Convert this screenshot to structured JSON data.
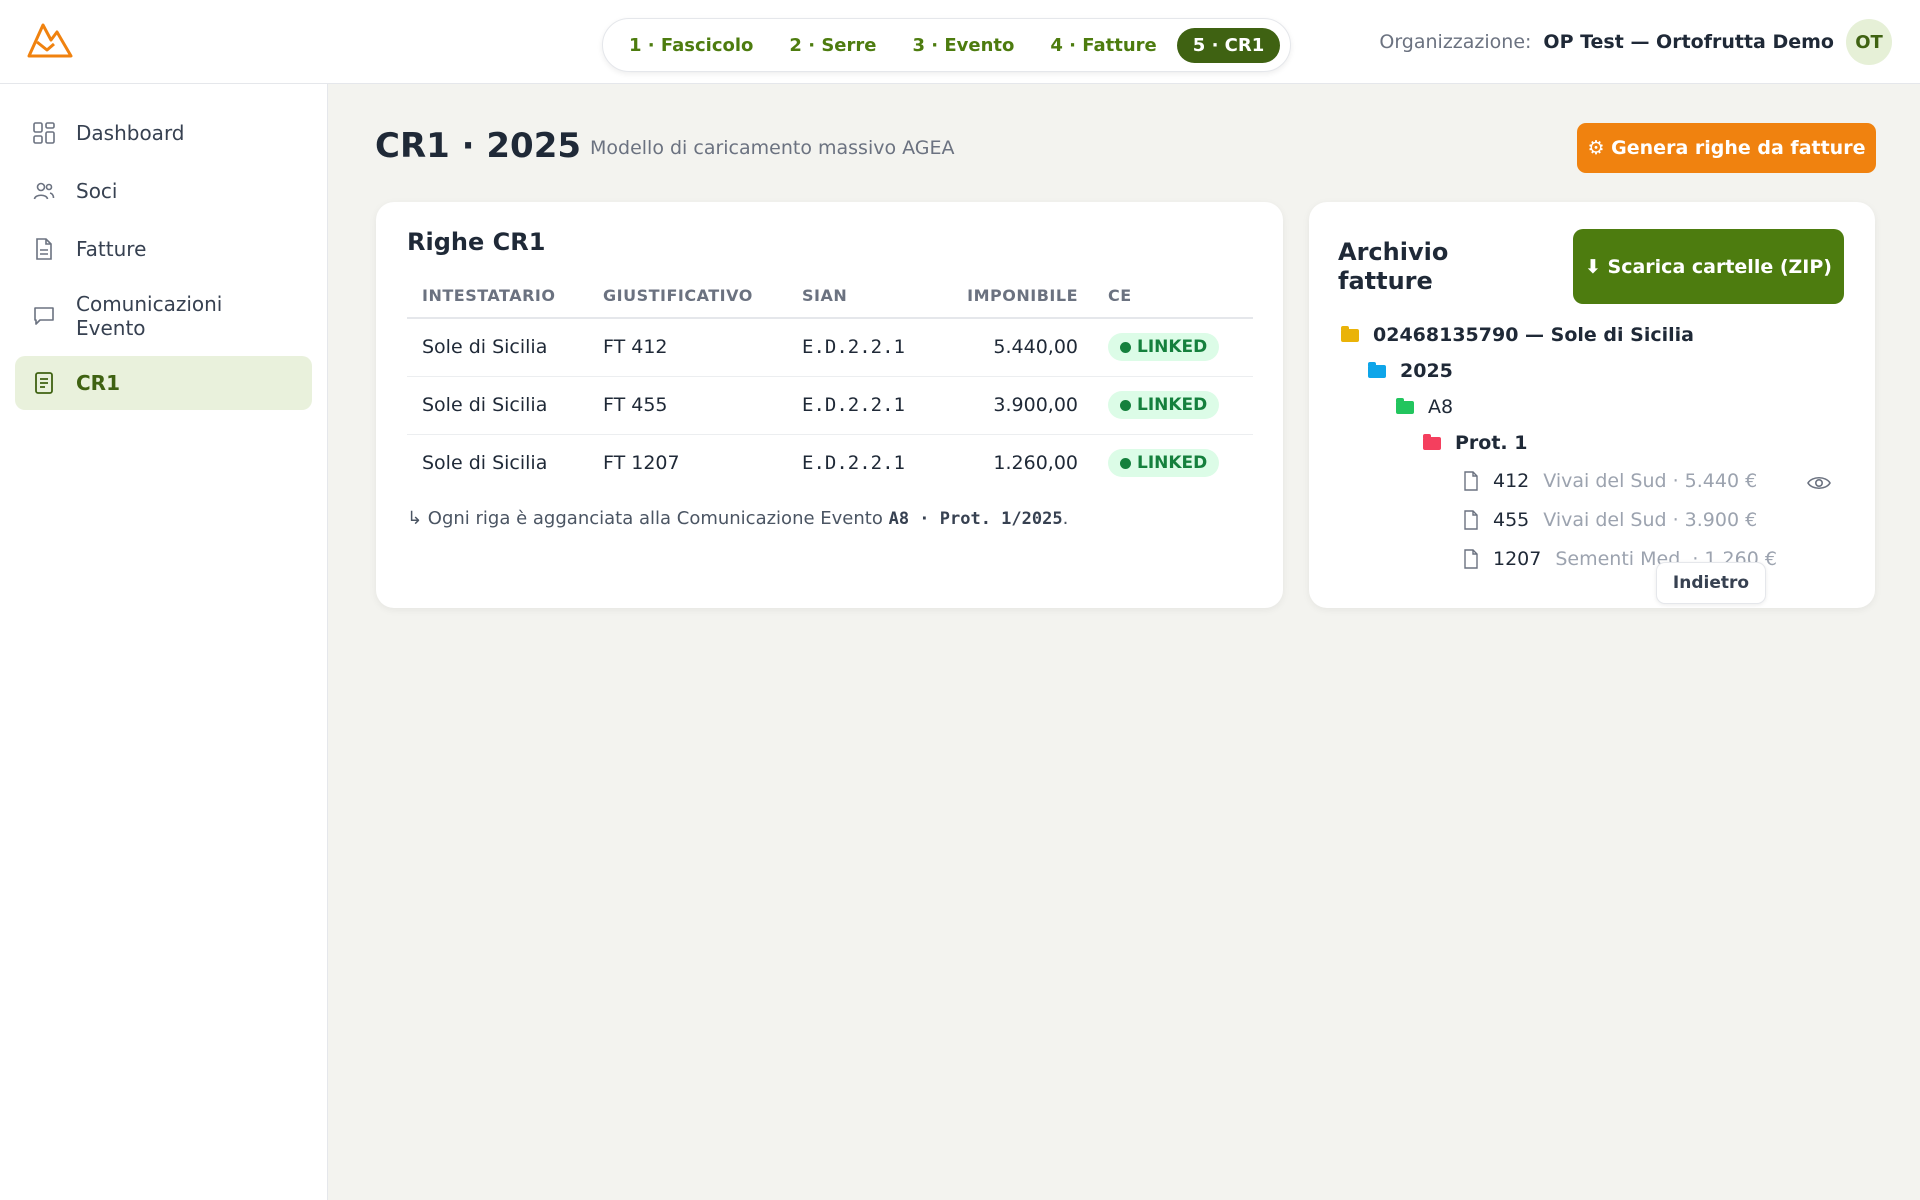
{
  "header": {
    "logo": "mountain-logo",
    "steps": [
      {
        "label": "1 · Fascicolo",
        "active": false
      },
      {
        "label": "2 · Serre",
        "active": false
      },
      {
        "label": "3 · Evento",
        "active": false
      },
      {
        "label": "4 · Fatture",
        "active": false
      },
      {
        "label": "5 · CR1",
        "active": true
      }
    ],
    "org_label": "Organizzazione:",
    "org_name": "OP Test — Ortofrutta Demo",
    "avatar_initials": "OT"
  },
  "sidebar": {
    "items": [
      {
        "label": "Dashboard",
        "icon": "grid-icon",
        "active": false
      },
      {
        "label": "Soci",
        "icon": "users-icon",
        "active": false
      },
      {
        "label": "Fatture",
        "icon": "document-icon",
        "active": false
      },
      {
        "label": "Comunicazioni Evento",
        "icon": "message-icon",
        "active": false
      },
      {
        "label": "CR1",
        "icon": "list-document-icon",
        "active": true
      }
    ]
  },
  "page": {
    "title": "CR1 · 2025",
    "subtitle": "Modello di caricamento massivo AGEA",
    "generate_button": "⚙ Genera righe da fatture"
  },
  "rows_card": {
    "title": "Righe CR1",
    "columns": [
      "INTESTATARIO",
      "GIUSTIFICATIVO",
      "SIAN",
      "IMPONIBILE",
      "CE"
    ],
    "rows": [
      {
        "intestatario": "Sole di Sicilia",
        "giustificativo": "FT 412",
        "sian": "E.D.2.2.1",
        "imponibile": "5.440,00",
        "ce": "LINKED"
      },
      {
        "intestatario": "Sole di Sicilia",
        "giustificativo": "FT 455",
        "sian": "E.D.2.2.1",
        "imponibile": "3.900,00",
        "ce": "LINKED"
      },
      {
        "intestatario": "Sole di Sicilia",
        "giustificativo": "FT 1207",
        "sian": "E.D.2.2.1",
        "imponibile": "1.260,00",
        "ce": "LINKED"
      }
    ],
    "note_prefix": "↳ Ogni riga è agganciata alla Comunicazione Evento",
    "note_code": "A8 · Prot. 1/2025",
    "note_suffix": "."
  },
  "archive": {
    "title": "Archivio fatture",
    "zip_button": "⬇ Scarica cartelle (ZIP)",
    "tree": {
      "root": {
        "label": "02468135790 — Sole di Sicilia",
        "color": "#eab308"
      },
      "year": {
        "label": "2025",
        "color": "#0ea5e9"
      },
      "event": {
        "label": "A8",
        "color": "#22c55e"
      },
      "prot": {
        "label": "Prot. 1",
        "color": "#f43f5e"
      },
      "files": [
        {
          "number": "412",
          "meta": "Vivai del Sud · 5.440 €"
        },
        {
          "number": "455",
          "meta": "Vivai del Sud · 3.900 €"
        },
        {
          "number": "1207",
          "meta": "Sementi Med. · 1.260 €"
        }
      ]
    },
    "back_button": "Indietro"
  },
  "colors": {
    "accent_green": "#3f6212",
    "accent_orange": "#f0820f",
    "zip_green": "#4d7c0f",
    "badge_bg": "#dcfce7",
    "badge_text": "#15803d"
  }
}
